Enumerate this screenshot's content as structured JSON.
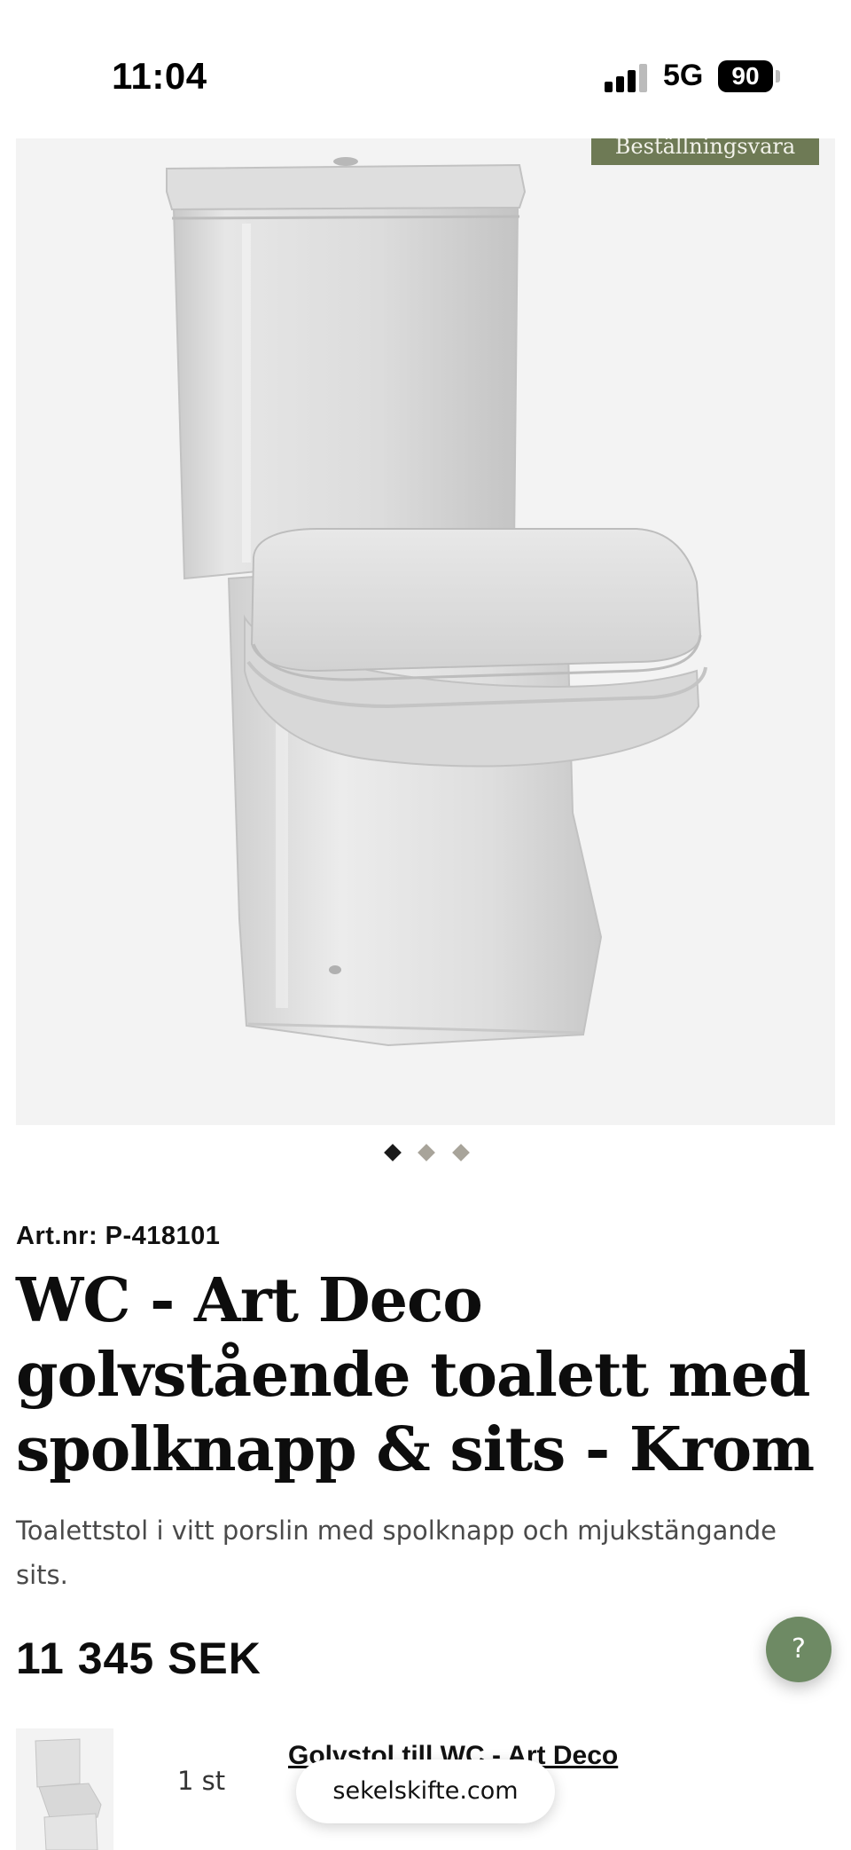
{
  "status_bar": {
    "time": "11:04",
    "network": "5G",
    "battery": "90"
  },
  "gallery": {
    "badge": "Beställningsvara",
    "image_icon": "toilet-product-photo",
    "slide_count": 3,
    "active_slide": 1
  },
  "product": {
    "artnr": "Art.nr: P-418101",
    "title": "WC - Art Deco golvstående toalett med spolknapp & sits - Krom",
    "description": "Toalettstol i vitt porslin med spolknapp och mjukstängande sits.",
    "price": "11 345 SEK"
  },
  "help": {
    "label": "?"
  },
  "bundle": {
    "quantity": "1 st",
    "item_link": "Golvstol till WC - Art Deco"
  },
  "browser": {
    "url": "sekelskifte.com"
  },
  "colors": {
    "badge": "#6e7a55",
    "help_button": "#6e8a64",
    "dot_active": "#1a1a1a",
    "dot_inactive": "#a8a49a"
  }
}
